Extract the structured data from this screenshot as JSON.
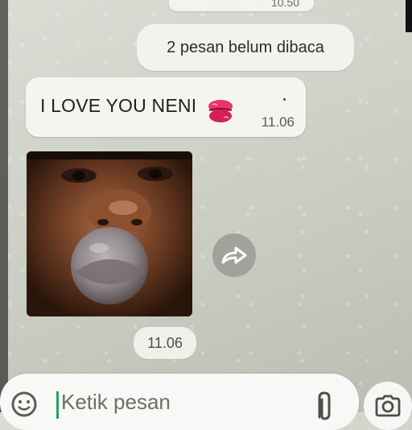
{
  "previous_message": {
    "time": "10.50"
  },
  "unread_banner": "2 pesan belum dibaca",
  "message_text": {
    "text": "I LOVE YOU NENI",
    "emoji": "kiss-mark-icon",
    "time": "11.06"
  },
  "image_message": {
    "time": "11.06"
  },
  "composer": {
    "placeholder": "Ketik pesan"
  },
  "colors": {
    "accent": "#2f9d6a",
    "bubble": "#f4f5f0",
    "wallpaper": "#d0d4ca"
  }
}
